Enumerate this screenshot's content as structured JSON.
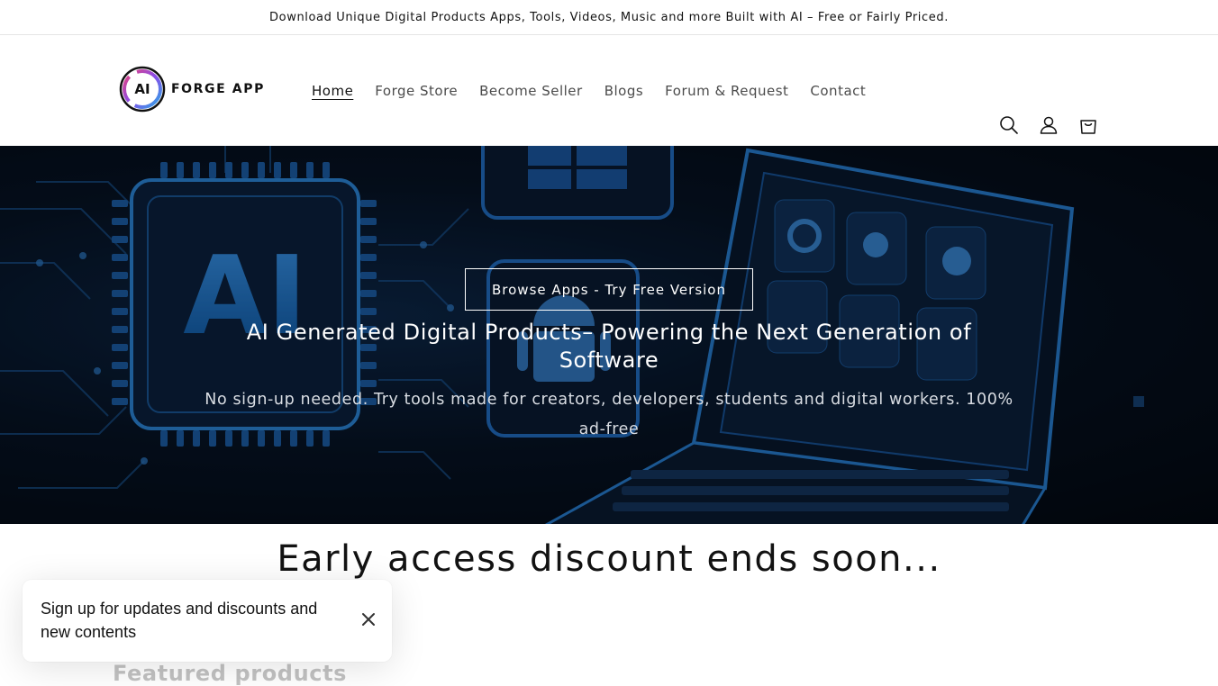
{
  "announcement": {
    "text": "Download Unique Digital Products Apps, Tools, Videos, Music and more Built with AI – Free or Fairly Priced."
  },
  "header": {
    "logo_mark": "AI",
    "logo_text": "FORGE APP",
    "nav": [
      {
        "label": "Home",
        "active": true
      },
      {
        "label": "Forge Store",
        "active": false
      },
      {
        "label": "Become Seller",
        "active": false
      },
      {
        "label": "Blogs",
        "active": false
      },
      {
        "label": "Forum & Request",
        "active": false
      },
      {
        "label": "Contact",
        "active": false
      }
    ],
    "icons": [
      "search-icon",
      "account-icon",
      "cart-icon"
    ]
  },
  "hero": {
    "button_label": "Browse Apps - Try Free Version",
    "heading": "AI Generated Digital Products– Powering the Next Generation of Software",
    "subheading": "No sign-up needed. Try tools made for creators, developers, students and digital workers. 100% ad-free",
    "art_text": "AI"
  },
  "countdown": {
    "heading": "Early access discount ends soon..."
  },
  "featured": {
    "heading": "Featured products"
  },
  "popup": {
    "text": "Sign up for updates and discounts and new contents"
  },
  "colors": {
    "accent": "#121212",
    "hero_glow": "#1f7fd6",
    "hero_bg": "#071427"
  }
}
